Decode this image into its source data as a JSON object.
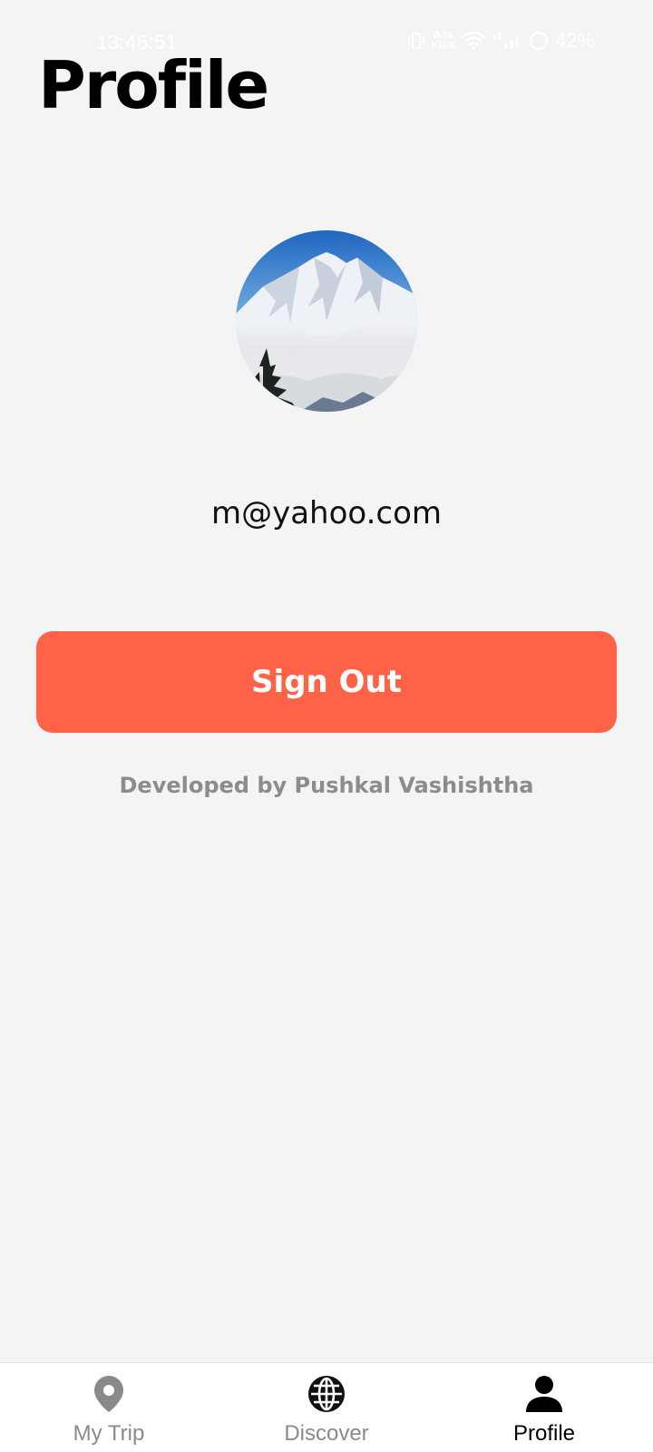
{
  "status_bar": {
    "time": "13:46:51",
    "net_speed_top": "0.38",
    "net_speed_bottom": "KB/S",
    "battery": "42%"
  },
  "page": {
    "title": "Profile"
  },
  "profile": {
    "avatar_icon": "mountain-avatar",
    "email": "m@yahoo.com"
  },
  "actions": {
    "sign_out_label": "Sign Out"
  },
  "footer": {
    "credit": "Developed by Pushkal Vashishtha"
  },
  "bottom_nav": {
    "items": [
      {
        "label": "My Trip",
        "icon": "location-pin-icon",
        "active": false
      },
      {
        "label": "Discover",
        "icon": "globe-icon",
        "active": false
      },
      {
        "label": "Profile",
        "icon": "person-icon",
        "active": true
      }
    ]
  },
  "colors": {
    "accent": "#ff6347",
    "background": "#f4f4f4",
    "nav_inactive": "#8a8a8a",
    "nav_active": "#000000"
  }
}
